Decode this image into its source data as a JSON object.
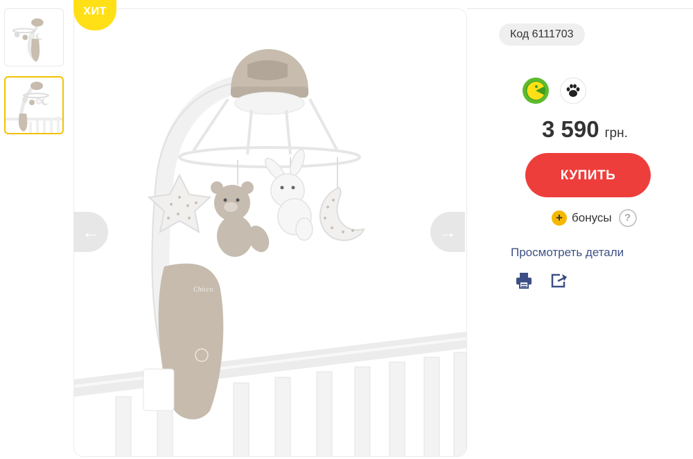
{
  "badge": {
    "label": "ХИТ"
  },
  "product": {
    "code_label": "Код 6111703",
    "price": "3 590",
    "currency": "грн.",
    "buy_label": "КУПИТЬ",
    "bonus_label": "бонусы",
    "bonus_help": "?",
    "details_label": "Просмотреть детали"
  },
  "gallery": {
    "prev_arrow": "←",
    "next_arrow": "→",
    "thumbnails": [
      "thumb-1",
      "thumb-2"
    ],
    "active_thumbnail": 1
  },
  "icons": {
    "badge_left": "green-pacman-icon",
    "badge_right": "paw-icon",
    "print": "print-icon",
    "share": "share-icon"
  },
  "colors": {
    "accent_yellow": "#ffe017",
    "buy_red": "#ee3e3c",
    "link_blue": "#3d4f86",
    "bonus_orange": "#f5b800"
  }
}
